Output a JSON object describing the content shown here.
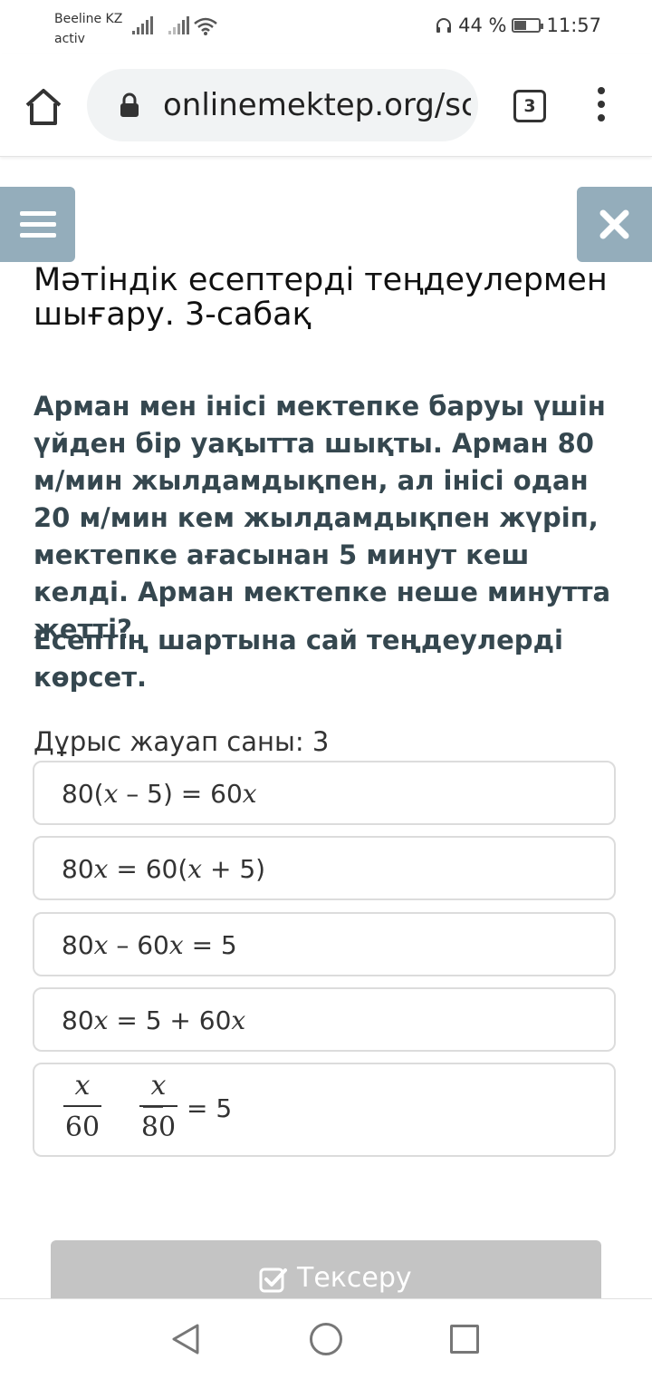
{
  "status_bar": {
    "carrier_line1": "Beeline KZ",
    "carrier_line2": "activ",
    "battery": "44 %",
    "time": "11:57"
  },
  "browser": {
    "url": "onlinemektep.org/sc",
    "tab_count": "3"
  },
  "page": {
    "title": "Мәтіндік есептерді теңдеулермен шығару. 3-сабақ",
    "question": "Арман мен інісі мектепке баруы үшін үйден бір уақытта шықты. Арман 80 м/мин жылдамдықпен, ал інісі одан 20 м/мин кем жылдамдықпен жүріп, мектепке ағасынан 5 минут кеш келді. Арман мектепке неше минутта жетті?",
    "instruction": "Есептің шартына сай теңдеулерді көрсет.",
    "answer_count": "Дұрыс жауап саны: 3",
    "options": [
      {
        "parts": [
          "80(",
          "x",
          " – 5) = 60",
          "x"
        ]
      },
      {
        "parts": [
          "80",
          "x",
          " = 60(",
          "x",
          " + 5)"
        ]
      },
      {
        "parts": [
          "80",
          "x",
          " – 60",
          "x",
          " = 5"
        ]
      },
      {
        "parts": [
          "80",
          "x",
          " = 5 + 60",
          "x"
        ]
      },
      {
        "fraction": {
          "num1": "x",
          "den1": "60",
          "num2": "x",
          "den2": "80",
          "rhs": "= 5"
        }
      }
    ],
    "check_button": "Тексеру"
  },
  "colors": {
    "accent": "#94adbb",
    "question_text": "#35474f",
    "disabled_button": "#c4c4c4"
  }
}
